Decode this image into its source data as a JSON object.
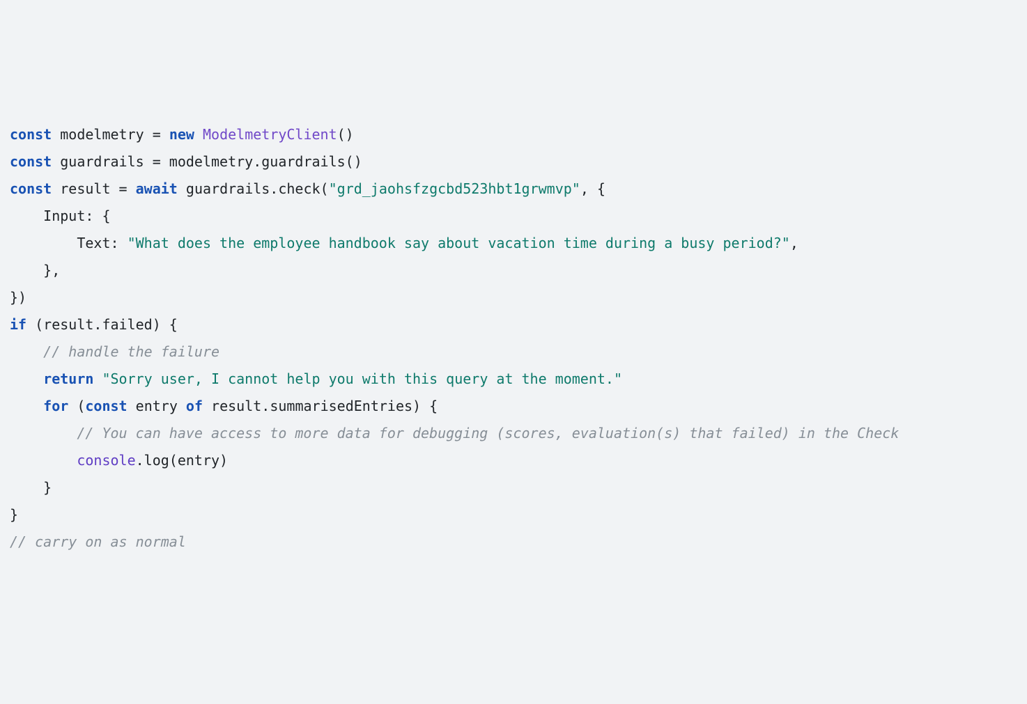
{
  "code": {
    "l1": {
      "kw_const1": "const",
      "id1": " modelmetry ",
      "eq1": "=",
      "sp1": " ",
      "kw_new": "new",
      "sp2": " ",
      "cls": "ModelmetryClient",
      "paren": "()"
    },
    "l2": {
      "kw_const": "const",
      "id": " guardrails ",
      "eq": "=",
      "rest": " modelmetry.guardrails()"
    },
    "l3": "",
    "l4": {
      "kw_const": "const",
      "id": " result ",
      "eq": "=",
      "sp": " ",
      "kw_await": "await",
      "mid": " guardrails.check(",
      "str": "\"grd_jaohsfzgcbd523hbt1grwmvp\"",
      "end": ", {"
    },
    "l5": "    Input: {",
    "l6": {
      "pre": "        Text: ",
      "str": "\"What does the employee handbook say about vacation time during a busy period?\"",
      "post": ","
    },
    "l7": "    },",
    "l8": "})",
    "l9": "",
    "l10": {
      "kw_if": "if",
      "rest": " (result.failed) {"
    },
    "l11": {
      "indent": "    ",
      "comment": "// handle the failure"
    },
    "l12": {
      "indent": "    ",
      "kw_return": "return",
      "sp": " ",
      "str": "\"Sorry user, I cannot help you with this query at the moment.\""
    },
    "l13": "",
    "l14": {
      "indent": "    ",
      "kw_for": "for",
      "p1": " (",
      "kw_const": "const",
      "mid": " entry ",
      "kw_of": "of",
      "rest": " result.summarisedEntries) {"
    },
    "l15": {
      "indent": "        ",
      "comment": "// You can have access to more data for debugging (scores, evaluation(s) that failed) in the Check"
    },
    "l16": {
      "indent": "        ",
      "console": "console",
      "rest": ".log(entry)"
    },
    "l17": "    }",
    "l18": "}",
    "l19": "",
    "l20": {
      "comment": "// carry on as normal"
    }
  }
}
